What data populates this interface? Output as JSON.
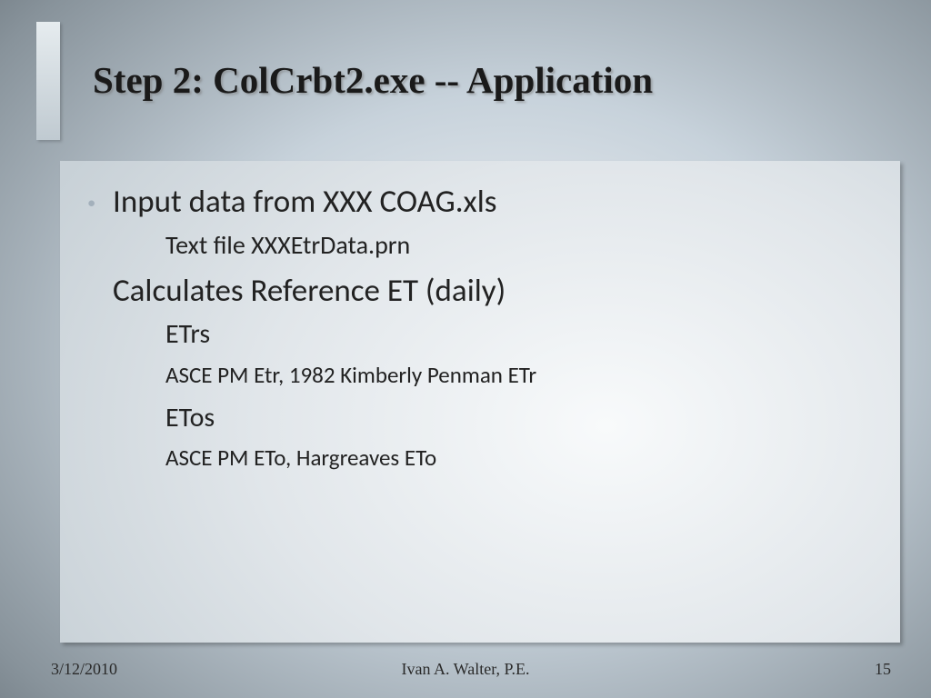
{
  "title": "Step 2:  ColCrbt2.exe   --  Application",
  "bullets": {
    "b1": "Input data from XXX COAG.xls",
    "b1a": "Text file   XXXEtrData.prn",
    "b2": "Calculates Reference ET  (daily)",
    "b2a": "ETrs",
    "b2a1": "ASCE PM Etr, 1982 Kimberly Penman ETr",
    "b2b": "ETos",
    "b2b1": "ASCE PM ETo, Hargreaves ETo"
  },
  "footer": {
    "date": "3/12/2010",
    "author": "Ivan A. Walter, P.E.",
    "page": "15"
  }
}
